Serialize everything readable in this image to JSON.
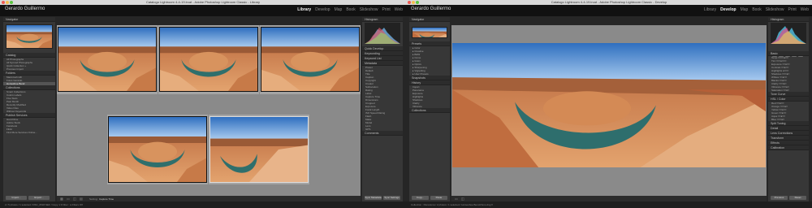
{
  "left": {
    "titlebar": "Catalogo Lightroom 4-4-19.lrcat - Adobe Photoshop Lightroom Classic - Library",
    "identity": "Gerardo Guillermo",
    "modules": [
      "Library",
      "Develop",
      "Map",
      "Book",
      "Slideshow",
      "Print",
      "Web"
    ],
    "active_module": "Library",
    "navigator": "Navigator",
    "catalog": "Catalog",
    "catalog_items": [
      "All Photographs",
      "All Synced Photographs",
      "Quick Collection +",
      "Previous Import"
    ],
    "folders": "Folders",
    "folder_items": [
      "Macintosh HD",
      "Fotos Gerardo",
      "Horseshoe Bend"
    ],
    "collections": "Collections",
    "collection_items": [
      "Smart Collections",
      "Colors Labels",
      "Five Stars",
      "Past Month",
      "Recently Modified",
      "Video Files",
      "Without Keywords"
    ],
    "publish": "Publish Services",
    "publish_items": [
      "Hard Drive",
      "Adobe Stock",
      "Facebook",
      "Flickr"
    ],
    "find_more": "Find More Services Online...",
    "buttons": [
      "Import...",
      "Export..."
    ],
    "histogram": "Histogram",
    "quick_develop": "Quick Develop",
    "keywording": "Keywording",
    "keyword_list": "Keyword List",
    "metadata": "Metadata",
    "comments": "Comments",
    "sync_buttons": [
      "Sync Metadata",
      "Sync Settings"
    ],
    "meta_rows": [
      "Preset",
      "Default",
      "Title",
      "Caption",
      "Copyright",
      "Creator",
      "Sublocation",
      "Rating",
      "Label",
      "Capture Time",
      "Dimensions",
      "Cropped",
      "Exposure",
      "Focal Length",
      "ISO Speed Rating",
      "Flash",
      "Make",
      "Model",
      "Lens",
      "GPS"
    ],
    "sort_label": "Sorting:",
    "sort_value": "Capture Time",
    "filmstrip": "2 / 5 photos / 1 selected / DSC_0518.NEF / Copy 1 ▾ Filter : ● Filters Off"
  },
  "right": {
    "titlebar": "Catalogo Lightroom 4-4-19.lrcat - Adobe Photoshop Lightroom Classic - Develop",
    "identity": "Gerardo Guillermo",
    "modules": [
      "Library",
      "Develop",
      "Map",
      "Book",
      "Slideshow",
      "Print",
      "Web"
    ],
    "active_module": "Develop",
    "navigator": "Navigator",
    "presets": "Presets",
    "snapshots": "Snapshots",
    "history": "History",
    "collections": "Collections",
    "buttons": [
      "Copy...",
      "Paste"
    ],
    "histogram": "Histogram",
    "panels_right": [
      "Basic",
      "Tone Curve",
      "HSL / Color",
      "Split Toning",
      "Detail",
      "Lens Corrections",
      "Transform",
      "Effects",
      "Calibration"
    ],
    "reset_buttons": [
      "Previous",
      "Reset"
    ],
    "filmstrip": "Collection : Panorama / 2 photos / 1 selected / Horseshoe Bend-Pano.dng ▾"
  }
}
